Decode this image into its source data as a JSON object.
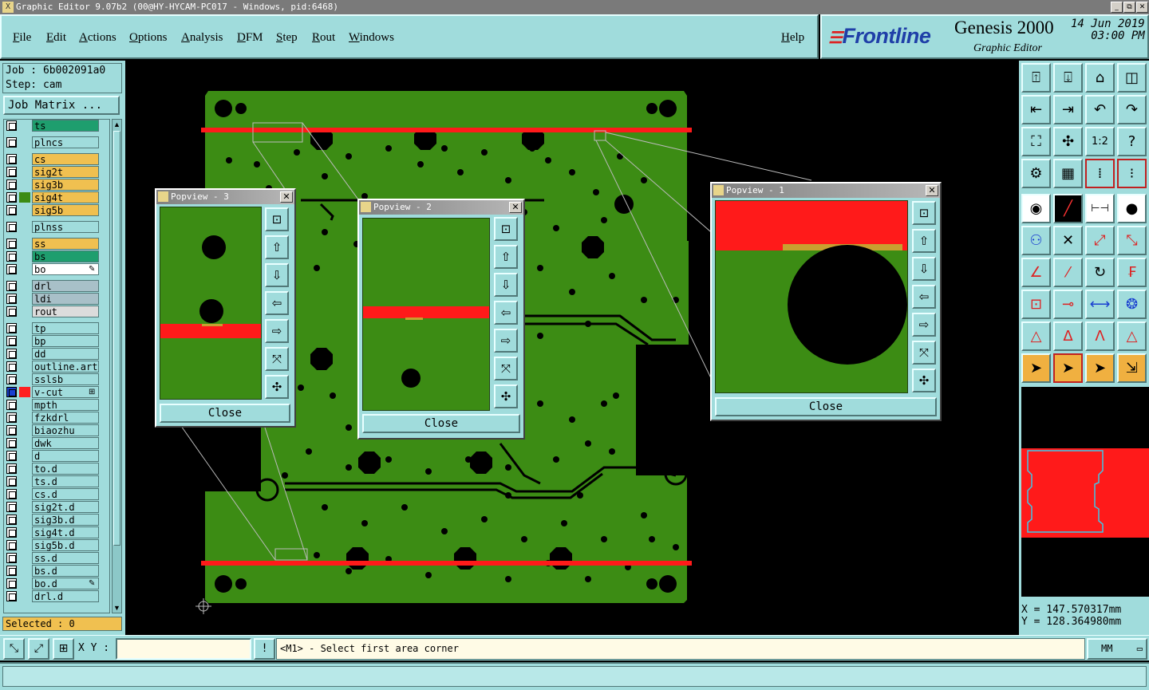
{
  "window": {
    "title": "Graphic Editor 9.07b2 (00@HY-HYCAM-PC017 - Windows, pid:6468)",
    "controls": [
      "_",
      "⧉",
      "✕"
    ]
  },
  "menu": {
    "items": [
      "File",
      "Edit",
      "Actions",
      "Options",
      "Analysis",
      "DFM",
      "Step",
      "Rout",
      "Windows"
    ],
    "help": "Help"
  },
  "brand": {
    "logo": "Frontline",
    "product": "Genesis 2000",
    "subtitle": "Graphic Editor",
    "date": "14 Jun 2019",
    "time": "03:00 PM"
  },
  "job": {
    "job_line": "Job : 6b002091a0",
    "step_line": "Step: cam",
    "matrix_button": "Job Matrix ..."
  },
  "layers": [
    {
      "name": "ts",
      "color": "#1e9e6e"
    },
    {
      "name": "plncs",
      "color": "#a0dcdc"
    },
    {
      "name": "cs",
      "color": "#f0c050"
    },
    {
      "name": "sig2t",
      "color": "#f0c050"
    },
    {
      "name": "sig3b",
      "color": "#f0c050"
    },
    {
      "name": "sig4t",
      "color": "#f0c050",
      "marker": "#3c8c14"
    },
    {
      "name": "sig5b",
      "color": "#f0c050"
    },
    {
      "name": "plnss",
      "color": "#a0dcdc"
    },
    {
      "name": "ss",
      "color": "#f0c050"
    },
    {
      "name": "bs",
      "color": "#1e9e6e"
    },
    {
      "name": "bo",
      "color": "#ffffff",
      "flag": "✎"
    },
    {
      "name": "drl",
      "color": "#a8c0c8"
    },
    {
      "name": "ldi",
      "color": "#a8c0c8"
    },
    {
      "name": "rout",
      "color": "#dcdcdc"
    },
    {
      "name": "tp",
      "color": "#a0dcdc"
    },
    {
      "name": "bp",
      "color": "#a0dcdc"
    },
    {
      "name": "dd",
      "color": "#a0dcdc"
    },
    {
      "name": "outline.art",
      "color": "#a0dcdc"
    },
    {
      "name": "sslsb",
      "color": "#a0dcdc"
    },
    {
      "name": "v-cut",
      "color": "#a0dcdc",
      "marker": "#ff2020",
      "checked": true,
      "flag": "⊞"
    },
    {
      "name": "mpth",
      "color": "#a0dcdc"
    },
    {
      "name": "fzkdrl",
      "color": "#a0dcdc"
    },
    {
      "name": "biaozhu",
      "color": "#a0dcdc"
    },
    {
      "name": "dwk",
      "color": "#a0dcdc"
    },
    {
      "name": "d",
      "color": "#a0dcdc"
    },
    {
      "name": "to.d",
      "color": "#a0dcdc"
    },
    {
      "name": "ts.d",
      "color": "#a0dcdc"
    },
    {
      "name": "cs.d",
      "color": "#a0dcdc"
    },
    {
      "name": "sig2t.d",
      "color": "#a0dcdc"
    },
    {
      "name": "sig3b.d",
      "color": "#a0dcdc"
    },
    {
      "name": "sig4t.d",
      "color": "#a0dcdc"
    },
    {
      "name": "sig5b.d",
      "color": "#a0dcdc"
    },
    {
      "name": "ss.d",
      "color": "#a0dcdc"
    },
    {
      "name": "bs.d",
      "color": "#a0dcdc"
    },
    {
      "name": "bo.d",
      "color": "#a0dcdc",
      "flag": "✎"
    },
    {
      "name": "drl.d",
      "color": "#a0dcdc"
    }
  ],
  "selected": "Selected : 0",
  "popviews": [
    {
      "title": "Popview - 3",
      "close": "Close"
    },
    {
      "title": "Popview - 2",
      "close": "Close"
    },
    {
      "title": "Popview - 1",
      "close": "Close"
    }
  ],
  "popview_tools": [
    "zoom-fit-icon",
    "arrow-up-icon",
    "arrow-down-icon",
    "arrow-left-icon",
    "arrow-right-icon",
    "zoom-in-icon",
    "zoom-out-icon"
  ],
  "coords": {
    "x": "X = 147.570317mm",
    "y": "Y = 128.364980mm"
  },
  "command": {
    "xy_label": "X Y :",
    "xy_value": "",
    "bang": "!",
    "prompt": "<M1> - Select first area corner",
    "units": "MM"
  },
  "colors": {
    "board": "#3c8c14",
    "vcut": "#ff1a1a",
    "panel": "#a0dcdc"
  }
}
